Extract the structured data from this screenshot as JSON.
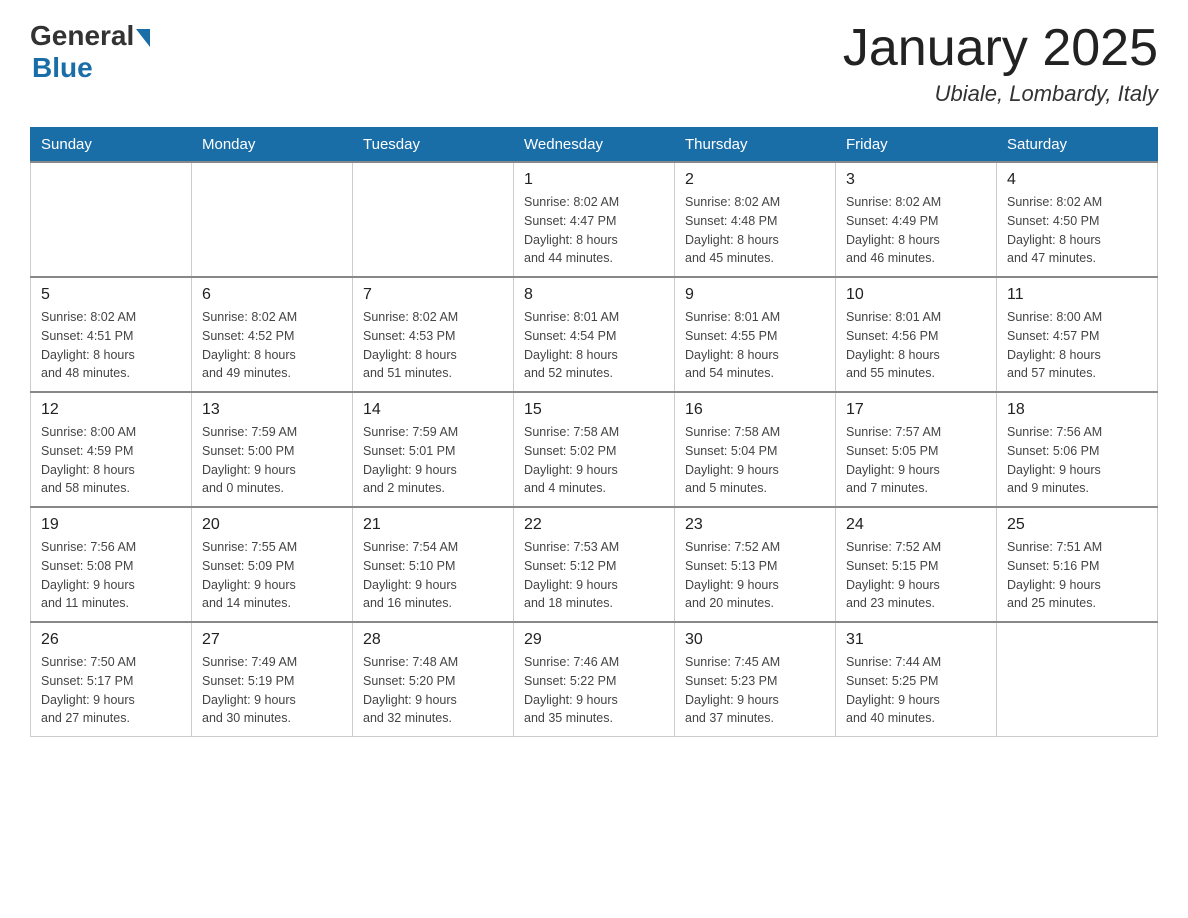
{
  "logo": {
    "general": "General",
    "blue": "Blue",
    "subtitle": ""
  },
  "header": {
    "title": "January 2025",
    "location": "Ubiale, Lombardy, Italy"
  },
  "days_of_week": [
    "Sunday",
    "Monday",
    "Tuesday",
    "Wednesday",
    "Thursday",
    "Friday",
    "Saturday"
  ],
  "weeks": [
    [
      {
        "day": "",
        "info": ""
      },
      {
        "day": "",
        "info": ""
      },
      {
        "day": "",
        "info": ""
      },
      {
        "day": "1",
        "info": "Sunrise: 8:02 AM\nSunset: 4:47 PM\nDaylight: 8 hours\nand 44 minutes."
      },
      {
        "day": "2",
        "info": "Sunrise: 8:02 AM\nSunset: 4:48 PM\nDaylight: 8 hours\nand 45 minutes."
      },
      {
        "day": "3",
        "info": "Sunrise: 8:02 AM\nSunset: 4:49 PM\nDaylight: 8 hours\nand 46 minutes."
      },
      {
        "day": "4",
        "info": "Sunrise: 8:02 AM\nSunset: 4:50 PM\nDaylight: 8 hours\nand 47 minutes."
      }
    ],
    [
      {
        "day": "5",
        "info": "Sunrise: 8:02 AM\nSunset: 4:51 PM\nDaylight: 8 hours\nand 48 minutes."
      },
      {
        "day": "6",
        "info": "Sunrise: 8:02 AM\nSunset: 4:52 PM\nDaylight: 8 hours\nand 49 minutes."
      },
      {
        "day": "7",
        "info": "Sunrise: 8:02 AM\nSunset: 4:53 PM\nDaylight: 8 hours\nand 51 minutes."
      },
      {
        "day": "8",
        "info": "Sunrise: 8:01 AM\nSunset: 4:54 PM\nDaylight: 8 hours\nand 52 minutes."
      },
      {
        "day": "9",
        "info": "Sunrise: 8:01 AM\nSunset: 4:55 PM\nDaylight: 8 hours\nand 54 minutes."
      },
      {
        "day": "10",
        "info": "Sunrise: 8:01 AM\nSunset: 4:56 PM\nDaylight: 8 hours\nand 55 minutes."
      },
      {
        "day": "11",
        "info": "Sunrise: 8:00 AM\nSunset: 4:57 PM\nDaylight: 8 hours\nand 57 minutes."
      }
    ],
    [
      {
        "day": "12",
        "info": "Sunrise: 8:00 AM\nSunset: 4:59 PM\nDaylight: 8 hours\nand 58 minutes."
      },
      {
        "day": "13",
        "info": "Sunrise: 7:59 AM\nSunset: 5:00 PM\nDaylight: 9 hours\nand 0 minutes."
      },
      {
        "day": "14",
        "info": "Sunrise: 7:59 AM\nSunset: 5:01 PM\nDaylight: 9 hours\nand 2 minutes."
      },
      {
        "day": "15",
        "info": "Sunrise: 7:58 AM\nSunset: 5:02 PM\nDaylight: 9 hours\nand 4 minutes."
      },
      {
        "day": "16",
        "info": "Sunrise: 7:58 AM\nSunset: 5:04 PM\nDaylight: 9 hours\nand 5 minutes."
      },
      {
        "day": "17",
        "info": "Sunrise: 7:57 AM\nSunset: 5:05 PM\nDaylight: 9 hours\nand 7 minutes."
      },
      {
        "day": "18",
        "info": "Sunrise: 7:56 AM\nSunset: 5:06 PM\nDaylight: 9 hours\nand 9 minutes."
      }
    ],
    [
      {
        "day": "19",
        "info": "Sunrise: 7:56 AM\nSunset: 5:08 PM\nDaylight: 9 hours\nand 11 minutes."
      },
      {
        "day": "20",
        "info": "Sunrise: 7:55 AM\nSunset: 5:09 PM\nDaylight: 9 hours\nand 14 minutes."
      },
      {
        "day": "21",
        "info": "Sunrise: 7:54 AM\nSunset: 5:10 PM\nDaylight: 9 hours\nand 16 minutes."
      },
      {
        "day": "22",
        "info": "Sunrise: 7:53 AM\nSunset: 5:12 PM\nDaylight: 9 hours\nand 18 minutes."
      },
      {
        "day": "23",
        "info": "Sunrise: 7:52 AM\nSunset: 5:13 PM\nDaylight: 9 hours\nand 20 minutes."
      },
      {
        "day": "24",
        "info": "Sunrise: 7:52 AM\nSunset: 5:15 PM\nDaylight: 9 hours\nand 23 minutes."
      },
      {
        "day": "25",
        "info": "Sunrise: 7:51 AM\nSunset: 5:16 PM\nDaylight: 9 hours\nand 25 minutes."
      }
    ],
    [
      {
        "day": "26",
        "info": "Sunrise: 7:50 AM\nSunset: 5:17 PM\nDaylight: 9 hours\nand 27 minutes."
      },
      {
        "day": "27",
        "info": "Sunrise: 7:49 AM\nSunset: 5:19 PM\nDaylight: 9 hours\nand 30 minutes."
      },
      {
        "day": "28",
        "info": "Sunrise: 7:48 AM\nSunset: 5:20 PM\nDaylight: 9 hours\nand 32 minutes."
      },
      {
        "day": "29",
        "info": "Sunrise: 7:46 AM\nSunset: 5:22 PM\nDaylight: 9 hours\nand 35 minutes."
      },
      {
        "day": "30",
        "info": "Sunrise: 7:45 AM\nSunset: 5:23 PM\nDaylight: 9 hours\nand 37 minutes."
      },
      {
        "day": "31",
        "info": "Sunrise: 7:44 AM\nSunset: 5:25 PM\nDaylight: 9 hours\nand 40 minutes."
      },
      {
        "day": "",
        "info": ""
      }
    ]
  ]
}
